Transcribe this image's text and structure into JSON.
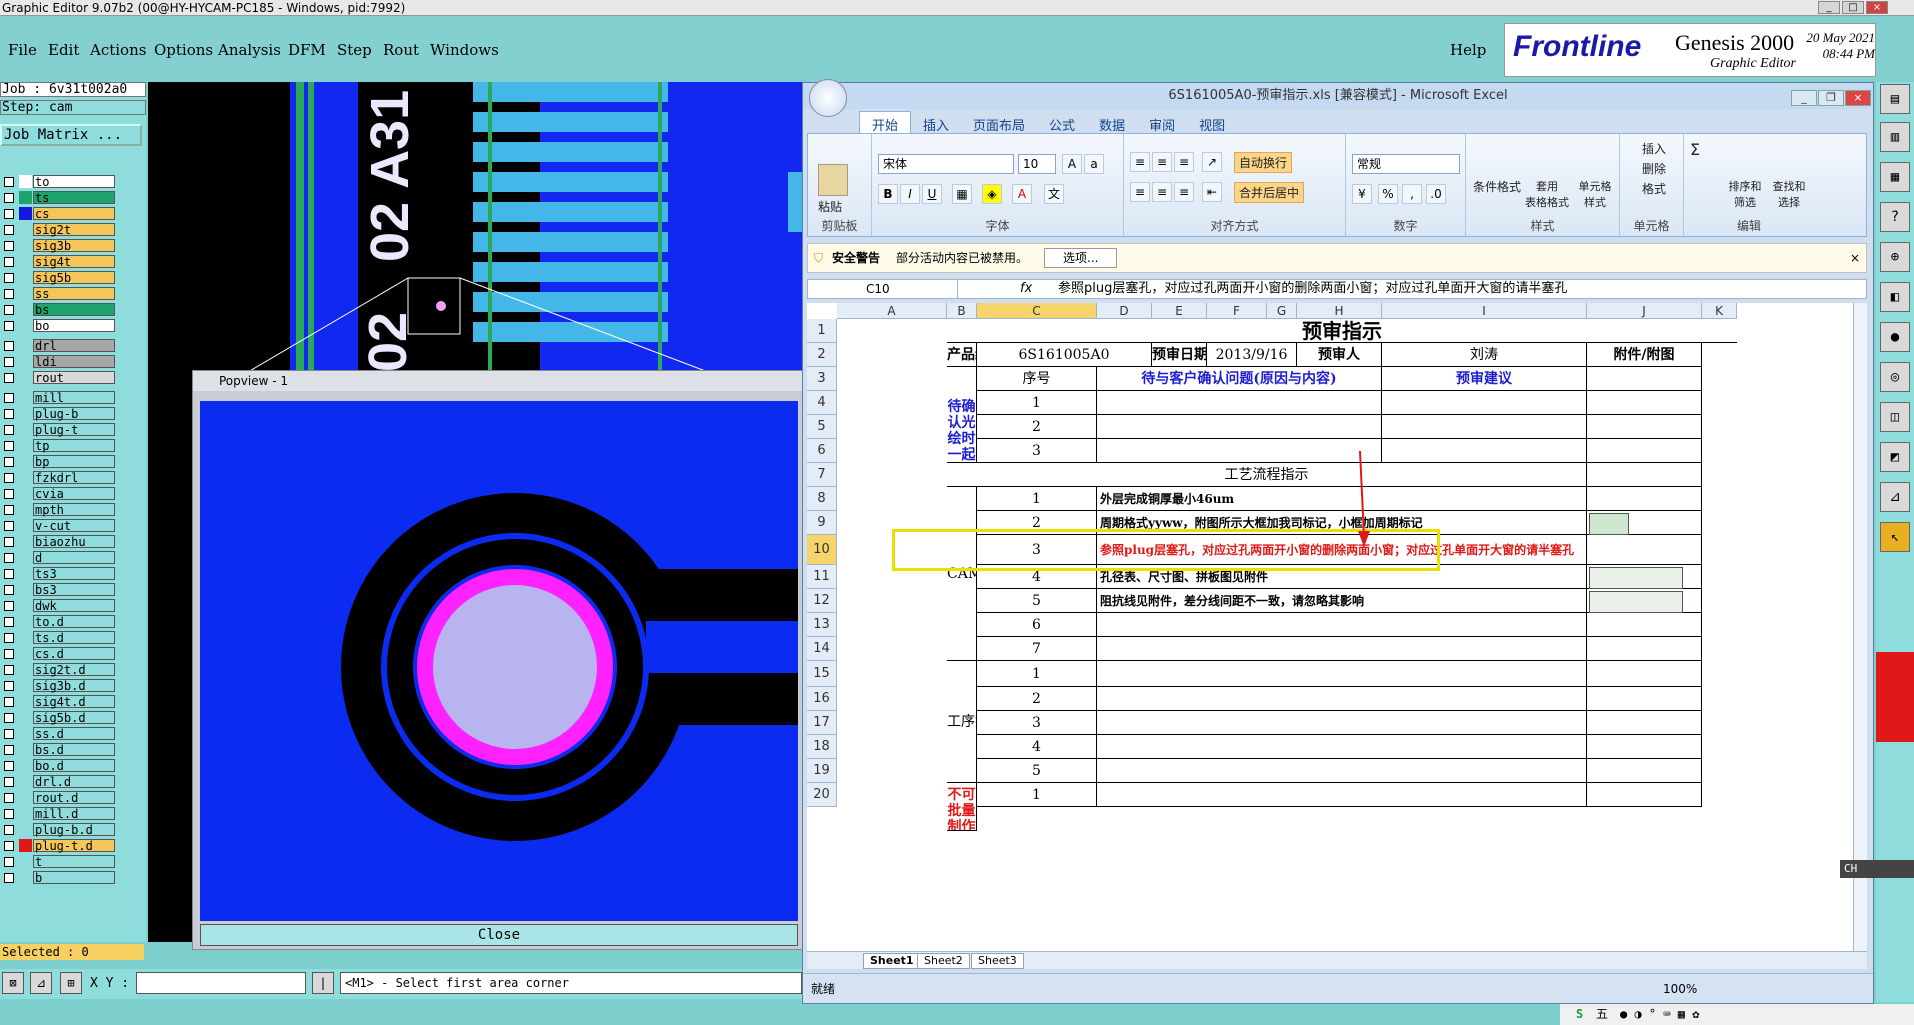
{
  "window_title": "Graphic Editor 9.07b2 (00@HY-HYCAM-PC185 - Windows, pid:7992)",
  "menu": [
    "File",
    "Edit",
    "Actions",
    "Options",
    "Analysis",
    "DFM",
    "Step",
    "Rout",
    "Windows"
  ],
  "help": "Help",
  "brand": {
    "logo": "Frontline",
    "product": "Genesis 2000",
    "subtitle": "Graphic Editor",
    "date": "20 May 2021",
    "time": "08:44 PM"
  },
  "job_line": "Job : 6v31t002a0",
  "step_line": "Step: cam",
  "job_matrix": "Job Matrix ...",
  "layers": [
    {
      "name": "to",
      "bg": "#ffffff",
      "swatch": "#ffffff"
    },
    {
      "name": "ts",
      "bg": "#1ea36d",
      "swatch": "#1ea36d"
    },
    {
      "name": "cs",
      "bg": "#f4c65a",
      "swatch": "#1418e0"
    },
    {
      "name": "sig2t",
      "bg": "#f4c65a",
      "swatch": ""
    },
    {
      "name": "sig3b",
      "bg": "#f4c65a",
      "swatch": ""
    },
    {
      "name": "sig4t",
      "bg": "#f4c65a",
      "swatch": ""
    },
    {
      "name": "sig5b",
      "bg": "#f4c65a",
      "swatch": ""
    },
    {
      "name": "ss",
      "bg": "#f4c65a",
      "swatch": ""
    },
    {
      "name": "bs",
      "bg": "#1ea36d",
      "swatch": ""
    },
    {
      "name": "bo",
      "bg": "#ffffff",
      "swatch": ""
    },
    {
      "name": "drl",
      "bg": "#a6a6a6",
      "swatch": ""
    },
    {
      "name": "ldi",
      "bg": "#a6a6a6",
      "swatch": ""
    },
    {
      "name": "rout",
      "bg": "#d9d9d9",
      "swatch": ""
    },
    {
      "name": "mill",
      "bg": "#8fdcdc",
      "swatch": ""
    },
    {
      "name": "plug-b",
      "bg": "#8fdcdc",
      "swatch": ""
    },
    {
      "name": "plug-t",
      "bg": "#8fdcdc",
      "swatch": ""
    },
    {
      "name": "tp",
      "bg": "#8fdcdc",
      "swatch": ""
    },
    {
      "name": "bp",
      "bg": "#8fdcdc",
      "swatch": ""
    },
    {
      "name": "fzkdrl",
      "bg": "#8fdcdc",
      "swatch": ""
    },
    {
      "name": "cvia",
      "bg": "#8fdcdc",
      "swatch": ""
    },
    {
      "name": "mpth",
      "bg": "#8fdcdc",
      "swatch": ""
    },
    {
      "name": "v-cut",
      "bg": "#8fdcdc",
      "swatch": ""
    },
    {
      "name": "biaozhu",
      "bg": "#8fdcdc",
      "swatch": ""
    },
    {
      "name": "d",
      "bg": "#8fdcdc",
      "swatch": ""
    },
    {
      "name": "ts3",
      "bg": "#8fdcdc",
      "swatch": ""
    },
    {
      "name": "bs3",
      "bg": "#8fdcdc",
      "swatch": ""
    },
    {
      "name": "dwk",
      "bg": "#8fdcdc",
      "swatch": ""
    },
    {
      "name": "to.d",
      "bg": "#8fdcdc",
      "swatch": ""
    },
    {
      "name": "ts.d",
      "bg": "#8fdcdc",
      "swatch": ""
    },
    {
      "name": "cs.d",
      "bg": "#8fdcdc",
      "swatch": ""
    },
    {
      "name": "sig2t.d",
      "bg": "#8fdcdc",
      "swatch": ""
    },
    {
      "name": "sig3b.d",
      "bg": "#8fdcdc",
      "swatch": ""
    },
    {
      "name": "sig4t.d",
      "bg": "#8fdcdc",
      "swatch": ""
    },
    {
      "name": "sig5b.d",
      "bg": "#8fdcdc",
      "swatch": ""
    },
    {
      "name": "ss.d",
      "bg": "#8fdcdc",
      "swatch": ""
    },
    {
      "name": "bs.d",
      "bg": "#8fdcdc",
      "swatch": ""
    },
    {
      "name": "bo.d",
      "bg": "#8fdcdc",
      "swatch": ""
    },
    {
      "name": "drl.d",
      "bg": "#8fdcdc",
      "swatch": ""
    },
    {
      "name": "rout.d",
      "bg": "#8fdcdc",
      "swatch": ""
    },
    {
      "name": "mill.d",
      "bg": "#8fdcdc",
      "swatch": ""
    },
    {
      "name": "plug-b.d",
      "bg": "#8fdcdc",
      "swatch": ""
    },
    {
      "name": "plug-t.d",
      "bg": "#f4c65a",
      "swatch": "#e01818"
    },
    {
      "name": "t",
      "bg": "#8fdcdc",
      "swatch": ""
    },
    {
      "name": "b",
      "bg": "#8fdcdc",
      "swatch": ""
    }
  ],
  "selected": "Selected : 0",
  "canvas_label": "02 A31 02",
  "canvas_label2": "02",
  "popview": {
    "title": "Popview - 1",
    "close": "Close"
  },
  "bottom": {
    "xy_label": "X Y :",
    "status": "<M1> - Select first area corner"
  },
  "excel": {
    "title": "6S161005A0-预审指示.xls [兼容模式] - Microsoft Excel",
    "tabs": [
      "开始",
      "插入",
      "页面布局",
      "公式",
      "数据",
      "审阅",
      "视图"
    ],
    "font_name": "宋体",
    "font_size": "10",
    "number_format": "常规",
    "groups": {
      "clipboard": "剪贴板",
      "font": "字体",
      "align": "对齐方式",
      "number": "数字",
      "style": "样式",
      "cells": "单元格",
      "edit": "编辑"
    },
    "buttons": {
      "paste": "粘贴",
      "wrap": "自动换行",
      "merge": "合并后居中",
      "cond": "条件格式",
      "table": "套用\n表格格式",
      "cellstyle": "单元格\n样式",
      "insert": "插入",
      "delete": "删除",
      "format": "格式",
      "sort": "排序和\n筛选",
      "find": "查找和\n选择"
    },
    "security": {
      "label": "安全警告",
      "msg": "部分活动内容已被禁用。",
      "btn": "选项..."
    },
    "namebox": "C10",
    "formula": "参照plug层塞孔，对应过孔两面开小窗的删除两面小窗；对应过孔单面开大窗的请半塞孔",
    "cols": [
      "A",
      "B",
      "C",
      "D",
      "E",
      "F",
      "G",
      "H",
      "I",
      "J",
      "K"
    ],
    "rows": [
      "1",
      "2",
      "3",
      "4",
      "5",
      "6",
      "7",
      "8",
      "9",
      "10",
      "11",
      "12",
      "13",
      "14",
      "15",
      "16",
      "17",
      "18",
      "19",
      "20"
    ],
    "cells": {
      "title": "预审指示",
      "prod_no_label": "产品编号",
      "prod_no": "6S161005A0",
      "date_label": "预审日期",
      "date": "2013/9/16",
      "reviewer_label": "预审人",
      "reviewer": "刘涛",
      "attach_label": "附件/附图",
      "seq_label": "序号",
      "issue_label": "待与客户确认问题(原因与内容)",
      "suggest_label": "预审建议",
      "pending_label": "待确认光绘时一起确认问题",
      "process_label": "工艺流程指示",
      "cam_label": "CAM指示",
      "proc_label": "工序指示",
      "hard_label": "不可批量制作的难点项目",
      "cam_items": [
        "外层完成铜厚最小46um",
        "周期格式yyww，附图所示大框加我司标记，小框加周期标记",
        "参照plug层塞孔，对应过孔两面开小窗的删除两面小窗；对应过孔单面开大窗的请半塞孔",
        "孔径表、尺寸图、拼板图见附件",
        "阻抗线见附件，差分线间距不一致，请忽略其影响"
      ],
      "nums": [
        "1",
        "2",
        "3",
        "4",
        "5",
        "6",
        "7"
      ]
    },
    "sheets": [
      "Sheet1",
      "Sheet2",
      "Sheet3"
    ],
    "status": "就绪",
    "zoom": "100%"
  },
  "taskbar": "五",
  "ime": "CH"
}
